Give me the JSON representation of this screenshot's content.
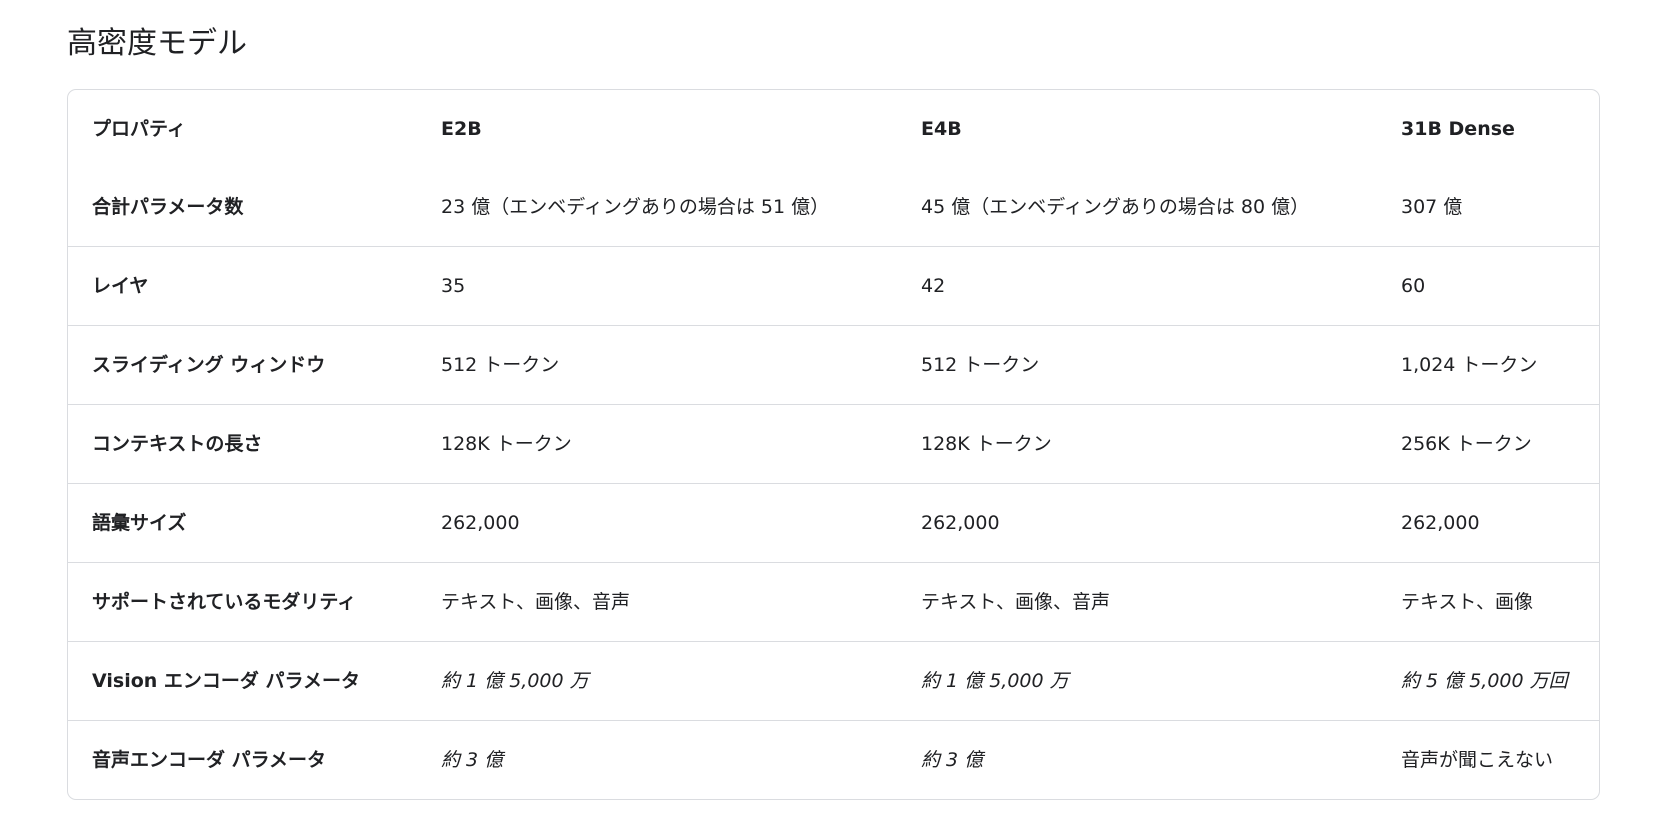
{
  "title": "高密度モデル",
  "table": {
    "headers": [
      "プロパティ",
      "E2B",
      "E4B",
      "31B Dense"
    ],
    "rows": [
      {
        "label": "合計パラメータ数",
        "e2b": "23 億（エンベディングありの場合は 51 億）",
        "e4b": "45 億（エンベディングありの場合は 80 億）",
        "dense31b": "307 億"
      },
      {
        "label": "レイヤ",
        "e2b": "35",
        "e4b": "42",
        "dense31b": "60"
      },
      {
        "label": "スライディング ウィンドウ",
        "e2b": "512 トークン",
        "e4b": "512 トークン",
        "dense31b": "1,024 トークン"
      },
      {
        "label": "コンテキストの長さ",
        "e2b": "128K トークン",
        "e4b": "128K トークン",
        "dense31b": "256K トークン"
      },
      {
        "label": "語彙サイズ",
        "e2b": "262,000",
        "e4b": "262,000",
        "dense31b": "262,000"
      },
      {
        "label": "サポートされているモダリティ",
        "e2b": "テキスト、画像、音声",
        "e4b": "テキスト、画像、音声",
        "dense31b": "テキスト、画像"
      },
      {
        "label": "Vision エンコーダ パラメータ",
        "e2b": "約 1 億 5,000 万",
        "e4b": "約 1 億 5,000 万",
        "dense31b": "約 5 億 5,000 万回"
      },
      {
        "label": "音声エンコーダ パラメータ",
        "e2b": "約 3 億",
        "e4b": "約 3 億",
        "dense31b": "音声が聞こえない"
      }
    ]
  }
}
